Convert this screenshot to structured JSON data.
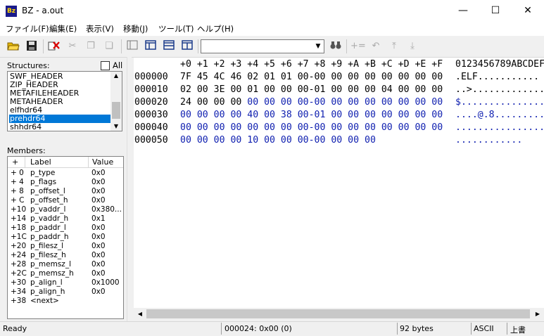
{
  "window": {
    "icon_text": "Bz",
    "title": "BZ - a.out"
  },
  "menu": [
    "ファイル(F)",
    "編集(E)",
    "表示(V)",
    "移動(J)",
    "ツール(T)",
    "ヘルプ(H)"
  ],
  "toolbar": {
    "combo_value": "",
    "icons": [
      "open-folder-icon",
      "save-icon",
      "delete-icon",
      "cut-icon",
      "copy-icon",
      "paste-icon",
      "single-pane-icon",
      "split-vertical-icon",
      "split-horizontal-icon",
      "split-side-icon",
      "find-icon",
      "increment-icon",
      "undo-icon",
      "jump-up-icon",
      "jump-down-icon"
    ]
  },
  "structures": {
    "label": "Structures:",
    "all_label": "All",
    "items": [
      "SWF_HEADER",
      "ZIP_HEADER",
      "METAFILEHEADER",
      "METAHEADER",
      "elfhdr64",
      "prehdr64",
      "shhdr64"
    ],
    "selected": "prehdr64"
  },
  "members": {
    "label": "Members:",
    "columns": [
      "+",
      "Label",
      "Value"
    ],
    "rows": [
      {
        "offset": "+ 0",
        "label": "p_type",
        "value": "0x0"
      },
      {
        "offset": "+ 4",
        "label": "p_flags",
        "value": "0x0"
      },
      {
        "offset": "+ 8",
        "label": "p_offset_l",
        "value": "0x0"
      },
      {
        "offset": "+ C",
        "label": "p_offset_h",
        "value": "0x0"
      },
      {
        "offset": "+10",
        "label": "p_vaddr_l",
        "value": "0x380..."
      },
      {
        "offset": "+14",
        "label": "p_vaddr_h",
        "value": "0x1"
      },
      {
        "offset": "+18",
        "label": "p_paddr_l",
        "value": "0x0"
      },
      {
        "offset": "+1C",
        "label": "p_paddr_h",
        "value": "0x0"
      },
      {
        "offset": "+20",
        "label": "p_filesz_l",
        "value": "0x0"
      },
      {
        "offset": "+24",
        "label": "p_filesz_h",
        "value": "0x0"
      },
      {
        "offset": "+28",
        "label": "p_memsz_l",
        "value": "0x0"
      },
      {
        "offset": "+2C",
        "label": "p_memsz_h",
        "value": "0x0"
      },
      {
        "offset": "+30",
        "label": "p_align_l",
        "value": "0x1000"
      },
      {
        "offset": "+34",
        "label": "p_align_h",
        "value": "0x0"
      },
      {
        "offset": "+38",
        "label": "<next>",
        "value": ""
      }
    ]
  },
  "hex": {
    "header": "+0 +1 +2 +3 +4 +5 +6 +7 +8 +9 +A +B +C +D +E +F",
    "ascii_header": "0123456789ABCDEF",
    "rows": [
      {
        "addr": "000000",
        "black": "7F 45 4C 46 02 01 01 00-00 00 00 00 00 00 00 00",
        "blue": "",
        "ascii": ".ELF..........."
      },
      {
        "addr": "000010",
        "black": "02 00 3E 00 01 00 00 00-01 00 00 00 04 00 00 00",
        "blue": "",
        "ascii": "..>............."
      },
      {
        "addr": "000020",
        "black": "24 00 00 00 ",
        "blue": "00 00 00 00-00 00 00 00 00 00 00 00",
        "ascii": "$..............."
      },
      {
        "addr": "000030",
        "black": "",
        "blue": "00 00 00 00 40 00 38 00-01 00 00 00 00 00 00 00",
        "ascii": "....@.8........."
      },
      {
        "addr": "000040",
        "black": "",
        "blue": "00 00 00 00 00 00 00 00-00 00 00 00 00 00 00 00",
        "ascii": "................"
      },
      {
        "addr": "000050",
        "black": "",
        "blue": "00 00 00 00 10 00 00 00-00 00 00 00",
        "ascii": "............"
      }
    ]
  },
  "status": {
    "ready": "Ready",
    "position": "000024: 0x00 (0)",
    "size": "92 bytes",
    "encoding": "ASCII",
    "mode": "上書"
  }
}
